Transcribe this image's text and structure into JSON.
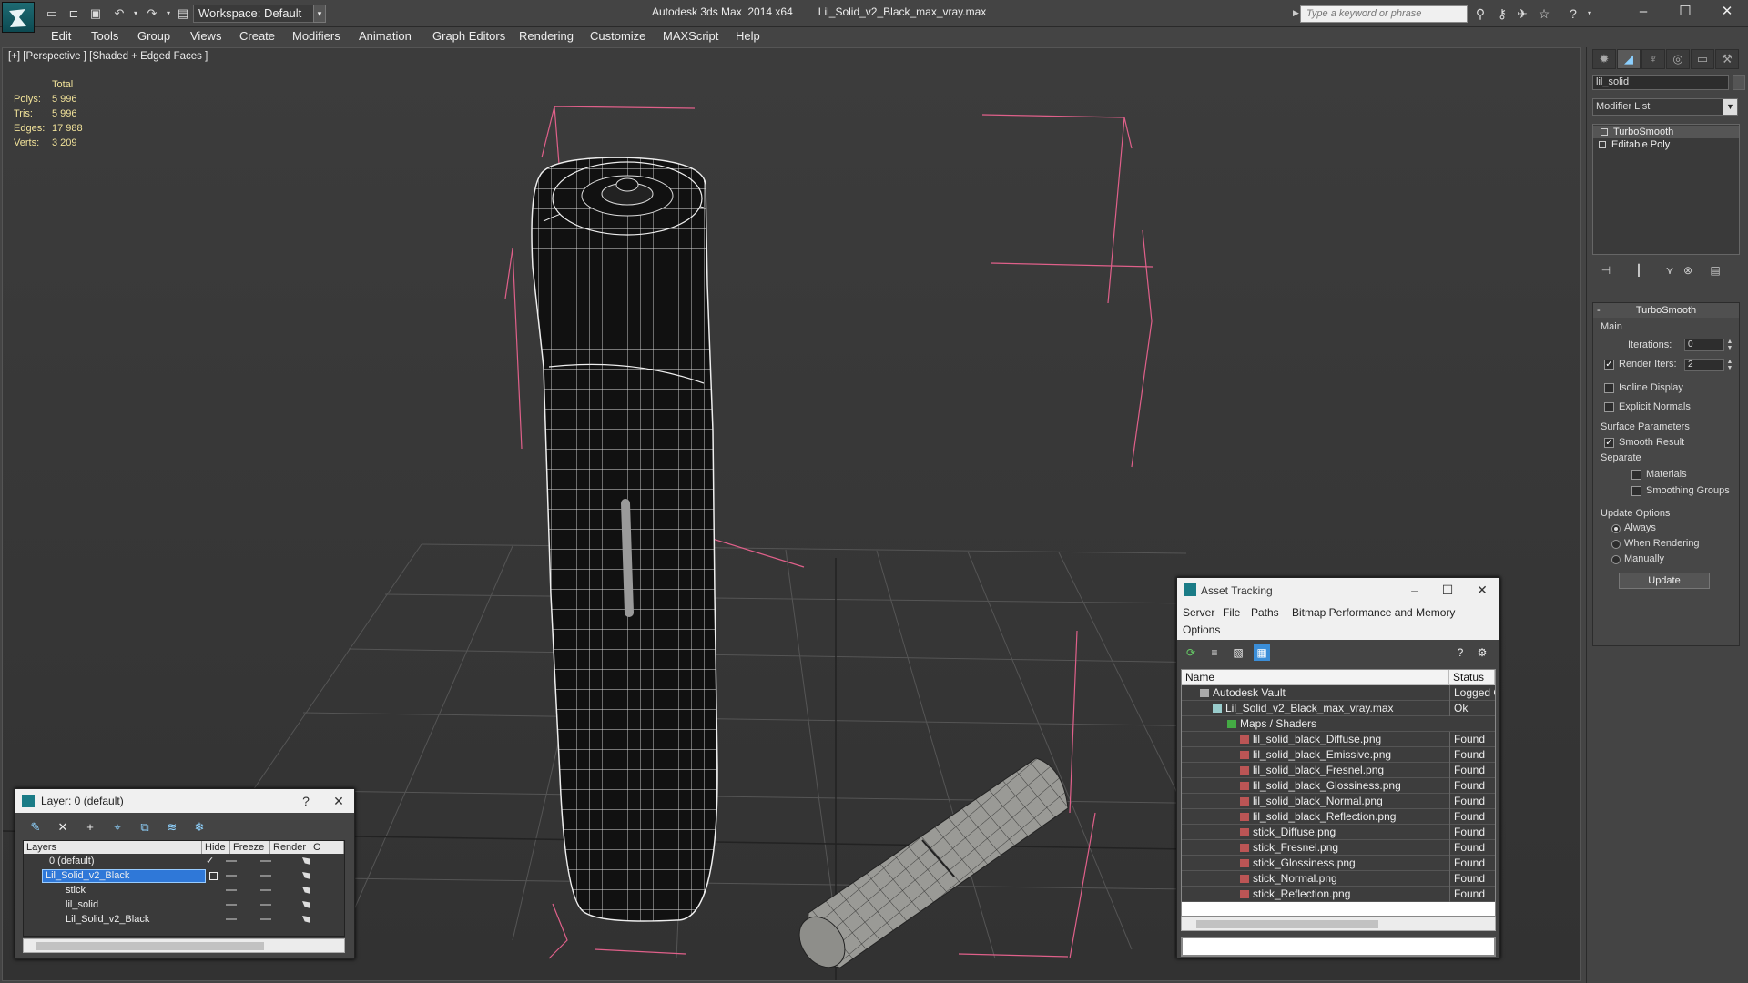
{
  "app": {
    "title": "Autodesk 3ds Max  2014 x64",
    "filename": "Lil_Solid_v2_Black_max_vray.max",
    "workspace": "Workspace: Default",
    "search_placeholder": "Type a keyword or phrase"
  },
  "menu": [
    "Edit",
    "Tools",
    "Group",
    "Views",
    "Create",
    "Modifiers",
    "Animation",
    "Graph Editors",
    "Rendering",
    "Customize",
    "MAXScript",
    "Help"
  ],
  "viewport": {
    "label": "[+] [Perspective ] [Shaded + Edged Faces ]",
    "stats": {
      "header": "Total",
      "rows": [
        {
          "label": "Polys:",
          "value": "5 996"
        },
        {
          "label": "Tris:",
          "value": "5 996"
        },
        {
          "label": "Edges:",
          "value": "17 988"
        },
        {
          "label": "Verts:",
          "value": "3 209"
        }
      ]
    }
  },
  "command_panel": {
    "object_name": "lil_solid",
    "modifier_list": "Modifier List",
    "stack": [
      "TurboSmooth",
      "Editable Poly"
    ],
    "turbosmooth": {
      "title": "TurboSmooth",
      "main": "Main",
      "iterations_label": "Iterations:",
      "iterations": "0",
      "render_iters_label": "Render Iters:",
      "render_iters": "2",
      "isoline": "Isoline Display",
      "explicit_normals": "Explicit Normals",
      "surface_params": "Surface Parameters",
      "smooth_result": "Smooth Result",
      "separate": "Separate",
      "materials": "Materials",
      "smoothing_groups": "Smoothing Groups",
      "update_options": "Update Options",
      "always": "Always",
      "when_rendering": "When Rendering",
      "manually": "Manually",
      "update_button": "Update"
    }
  },
  "layer_window": {
    "title": "Layer: 0 (default)",
    "help": "?",
    "columns": [
      "Layers",
      "Hide",
      "Freeze",
      "Render",
      "C"
    ],
    "rows": [
      "0 (default)",
      "Lil_Solid_v2_Black",
      "stick",
      "lil_solid",
      "Lil_Solid_v2_Black"
    ]
  },
  "asset_window": {
    "title": "Asset Tracking",
    "menu": [
      "Server",
      "File",
      "Paths",
      "Bitmap Performance and Memory",
      "Options"
    ],
    "columns": [
      "Name",
      "Status"
    ],
    "rows": [
      {
        "name": "Autodesk Vault",
        "status": "Logged Out"
      },
      {
        "name": "Lil_Solid_v2_Black_max_vray.max",
        "status": "Ok"
      },
      {
        "name": "Maps / Shaders",
        "status": ""
      },
      {
        "name": "lil_solid_black_Diffuse.png",
        "status": "Found"
      },
      {
        "name": "lil_solid_black_Emissive.png",
        "status": "Found"
      },
      {
        "name": "lil_solid_black_Fresnel.png",
        "status": "Found"
      },
      {
        "name": "lil_solid_black_Glossiness.png",
        "status": "Found"
      },
      {
        "name": "lil_solid_black_Normal.png",
        "status": "Found"
      },
      {
        "name": "lil_solid_black_Reflection.png",
        "status": "Found"
      },
      {
        "name": "stick_Diffuse.png",
        "status": "Found"
      },
      {
        "name": "stick_Fresnel.png",
        "status": "Found"
      },
      {
        "name": "stick_Glossiness.png",
        "status": "Found"
      },
      {
        "name": "stick_Normal.png",
        "status": "Found"
      },
      {
        "name": "stick_Reflection.png",
        "status": "Found"
      }
    ]
  }
}
